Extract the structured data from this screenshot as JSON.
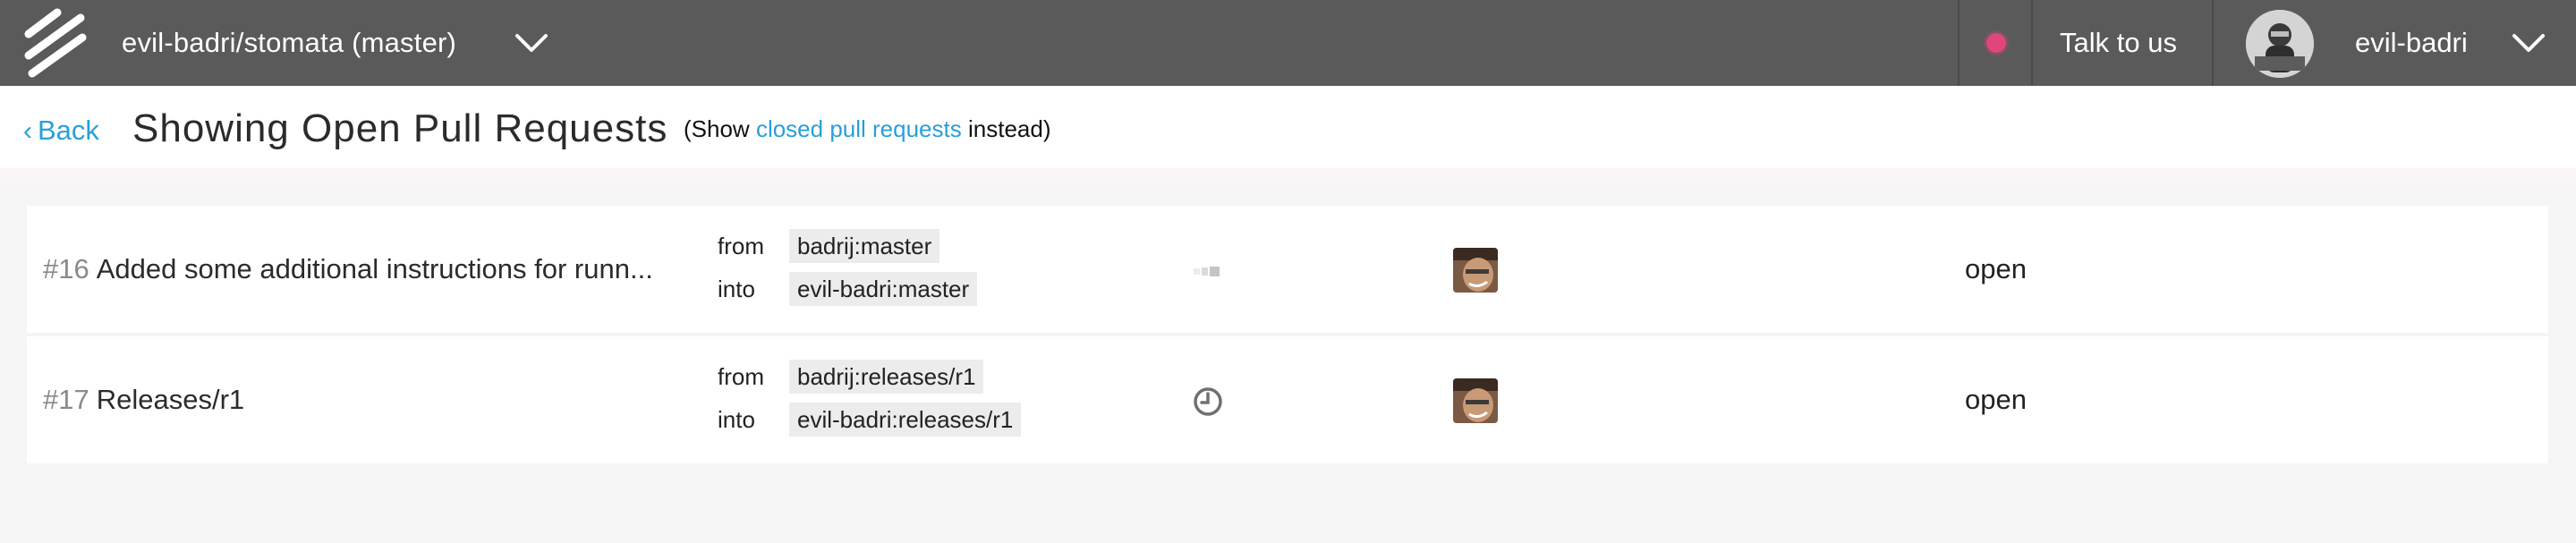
{
  "header": {
    "repo_title": "evil-badri/stomata (master)",
    "talk_label": "Talk to us",
    "username": "evil-badri",
    "status_color": "#e0457b"
  },
  "subheader": {
    "back_label": "Back",
    "title": "Showing Open Pull Requests",
    "alt_prefix": "(Show",
    "alt_link": "closed pull requests",
    "alt_suffix": "instead)"
  },
  "pull_requests": [
    {
      "number": "#16",
      "title": "Added some additional instructions for runn...",
      "from_label": "from",
      "from_branch": "badrij:master",
      "into_label": "into",
      "into_branch": "evil-badri:master",
      "ci_icon": "pending-bars-icon",
      "state": "open"
    },
    {
      "number": "#17",
      "title": "Releases/r1",
      "from_label": "from",
      "from_branch": "badrij:releases/r1",
      "into_label": "into",
      "into_branch": "evil-badri:releases/r1",
      "ci_icon": "clock-icon",
      "state": "open"
    }
  ],
  "colors": {
    "topbar": "#5a5a5a",
    "link": "#2a9fd6",
    "background": "#f5f5f5"
  }
}
